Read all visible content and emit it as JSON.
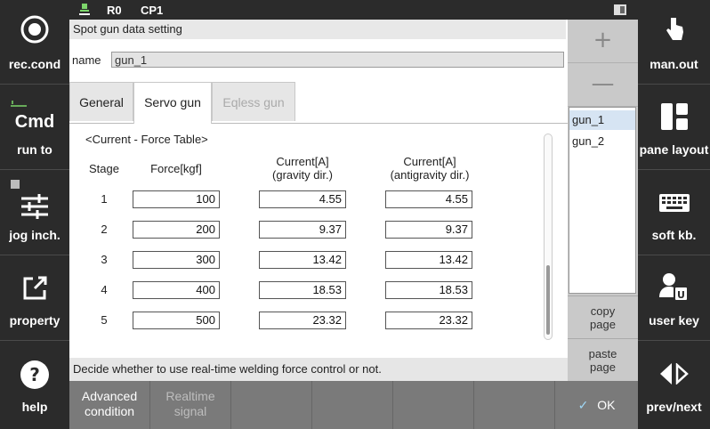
{
  "topbar": {
    "robot": "R0",
    "program": "CP1"
  },
  "left_sidebar": [
    {
      "label": "rec.cond",
      "icon": "record-circle-icon"
    },
    {
      "label": "run to",
      "icon": "cmd-icon",
      "top_label": "Cmd"
    },
    {
      "label": "jog inch.",
      "icon": "sliders-icon"
    },
    {
      "label": "property",
      "icon": "edit-box-icon"
    },
    {
      "label": "help",
      "icon": "help-circle-icon"
    }
  ],
  "right_sidebar": [
    {
      "label": "man.out",
      "icon": "hand-pointer-icon"
    },
    {
      "label": "pane layout",
      "icon": "pane-layout-icon"
    },
    {
      "label": "soft kb.",
      "icon": "keyboard-icon"
    },
    {
      "label": "user key",
      "icon": "user-key-icon"
    },
    {
      "label": "prev/next",
      "icon": "prev-next-arrows-icon"
    }
  ],
  "dialog": {
    "title": "Spot gun data setting",
    "name_label": "name",
    "name_value": "gun_1",
    "tabs": [
      {
        "label": "General",
        "state": "normal"
      },
      {
        "label": "Servo gun",
        "state": "active"
      },
      {
        "label": "Eqless gun",
        "state": "disabled"
      }
    ],
    "table_title": "<Current - Force Table>",
    "headers": {
      "stage": "Stage",
      "force": "Force[kgf]",
      "cur_gravity_1": "Current[A]",
      "cur_gravity_2": "(gravity dir.)",
      "cur_anti_1": "Current[A]",
      "cur_anti_2": "(antigravity dir.)"
    },
    "rows": [
      {
        "stage": "1",
        "force": "100",
        "gravity": "4.55",
        "antigravity": "4.55"
      },
      {
        "stage": "2",
        "force": "200",
        "gravity": "9.37",
        "antigravity": "9.37"
      },
      {
        "stage": "3",
        "force": "300",
        "gravity": "13.42",
        "antigravity": "13.42"
      },
      {
        "stage": "4",
        "force": "400",
        "gravity": "18.53",
        "antigravity": "18.53"
      },
      {
        "stage": "5",
        "force": "500",
        "gravity": "23.32",
        "antigravity": "23.32"
      }
    ],
    "status": "Decide whether to use real-time welding force control or not."
  },
  "gun_panel": {
    "plus": "+",
    "minus": "—",
    "items": [
      "gun_1",
      "gun_2"
    ],
    "selected": "gun_1",
    "copy_1": "copy",
    "copy_2": "page",
    "paste_1": "paste",
    "paste_2": "page"
  },
  "bottombar": {
    "advanced_1": "Advanced",
    "advanced_2": "condition",
    "realtime_1": "Realtime",
    "realtime_2": "signal",
    "ok": "OK"
  },
  "colors": {
    "sidebar": "#2b2b2b",
    "panel": "#c9c9c9",
    "bottombar": "#7a7a7a",
    "selection": "#d6e4f3"
  }
}
